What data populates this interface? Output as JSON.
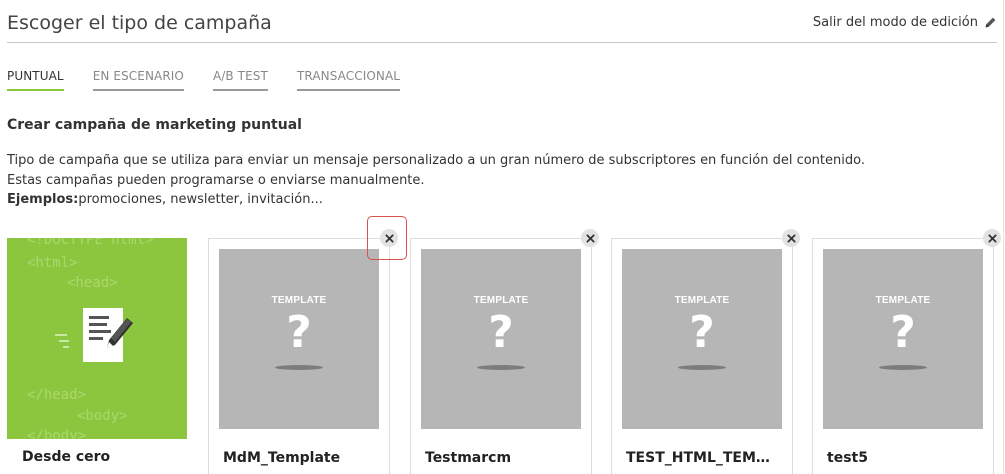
{
  "header": {
    "title": "Escoger el tipo de campaña",
    "exit_label": "Salir del modo de edición",
    "exit_icon": "pencil-icon"
  },
  "tabs": [
    {
      "label": "PUNTUAL",
      "active": true
    },
    {
      "label": "EN ESCENARIO",
      "active": false
    },
    {
      "label": "A/B TEST",
      "active": false
    },
    {
      "label": "TRANSACCIONAL",
      "active": false
    }
  ],
  "section": {
    "title": "Crear campaña de marketing puntual",
    "line1": "Tipo de campaña que se utiliza para enviar un mensaje personalizado a un gran número de subscriptores en función del contenido.",
    "line2": "Estas campañas pueden programarse o enviarse manualmente.",
    "examples_label": "Ejemplos:",
    "examples_text": "promociones, newsletter, invitación..."
  },
  "new_card": {
    "label": "Desde cero",
    "code": [
      "<!DOCTYPE html>",
      "<html>",
      "<head>",
      "</head>",
      "<body>",
      "</body>"
    ],
    "icon": "document-edit-icon"
  },
  "template_cards": [
    {
      "label": "MdM_Template",
      "placeholder_word": "TEMPLATE",
      "placeholder_mark": "?"
    },
    {
      "label": "Testmarcm",
      "placeholder_word": "TEMPLATE",
      "placeholder_mark": "?"
    },
    {
      "label": "TEST_HTML_TEMPLATE",
      "placeholder_word": "TEMPLATE",
      "placeholder_mark": "?"
    },
    {
      "label": "test5",
      "placeholder_word": "TEMPLATE",
      "placeholder_mark": "?"
    }
  ],
  "colors": {
    "accent": "#8cc63f",
    "placeholder_gray": "#b6b6b6",
    "highlight": "#d9534f"
  }
}
